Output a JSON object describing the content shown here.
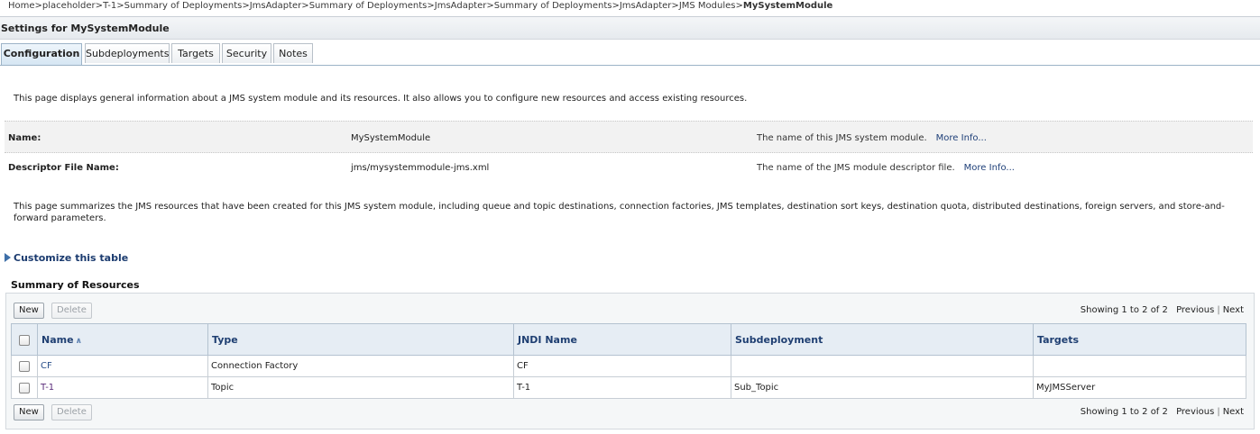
{
  "breadcrumb": {
    "items": [
      "Home",
      "placeholder",
      "T-1",
      "Summary of Deployments",
      "JmsAdapter",
      "Summary of Deployments",
      "JmsAdapter",
      "Summary of Deployments",
      "JmsAdapter",
      "JMS Modules"
    ],
    "separator": ">",
    "current": "MySystemModule"
  },
  "settings_title": "Settings for MySystemModule",
  "tabs": [
    "Configuration",
    "Subdeployments",
    "Targets",
    "Security",
    "Notes"
  ],
  "intro_text": "This page displays general information about a JMS system module and its resources. It also allows you to configure new resources and access existing resources.",
  "fields": [
    {
      "label": "Name:",
      "value": "MySystemModule",
      "description": "The name of this JMS system module.",
      "more": "More Info..."
    },
    {
      "label": "Descriptor File Name:",
      "value": "jms/mysystemmodule-jms.xml",
      "description": "The name of the JMS module descriptor file.",
      "more": "More Info..."
    }
  ],
  "summary_text": "This page summarizes the JMS resources that have been created for this JMS system module, including queue and topic destinations, connection factories, JMS templates, destination sort keys, destination quota, distributed destinations, foreign servers, and store-and-forward parameters.",
  "customize_label": "Customize this table",
  "summary_title": "Summary of Resources",
  "buttons": {
    "new": "New",
    "delete": "Delete"
  },
  "pager": {
    "showing": "Showing 1 to 2 of 2",
    "previous": "Previous",
    "separator": "|",
    "next": "Next"
  },
  "table": {
    "headers": [
      "Name",
      "Type",
      "JNDI Name",
      "Subdeployment",
      "Targets"
    ],
    "sort_icon": "sort-ascending-icon",
    "rows": [
      {
        "name": "CF",
        "type": "Connection Factory",
        "jndi": "CF",
        "subdeployment": "",
        "targets": ""
      },
      {
        "name": "T-1",
        "type": "Topic",
        "jndi": "T-1",
        "subdeployment": "Sub_Topic",
        "targets": "MyJMSServer"
      }
    ]
  },
  "colors": {
    "link_blue": "#1e3f78",
    "visited_purple": "#5a2c7a",
    "header_bg": "#e6edf4"
  }
}
